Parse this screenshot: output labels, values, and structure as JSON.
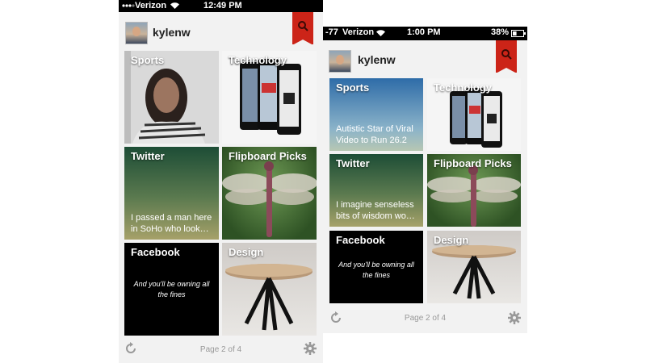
{
  "left_screen": {
    "status": {
      "carrier": "Verizon",
      "time": "12:49 PM"
    },
    "user": {
      "name": "kylenw"
    },
    "tiles": {
      "sports": {
        "label": "Sports"
      },
      "technology": {
        "label": "Technology"
      },
      "twitter": {
        "label": "Twitter",
        "text": "I passed a man here in SoHo who look…"
      },
      "flipboard_picks": {
        "label": "Flipboard Picks"
      },
      "facebook": {
        "label": "Facebook",
        "quote": "And you'll be owning all the fines"
      },
      "design": {
        "label": "Design"
      }
    },
    "footer": {
      "page": "Page 2 of 4"
    }
  },
  "right_screen": {
    "status": {
      "signal": "-77",
      "carrier": "Verizon",
      "time": "1:00 PM",
      "battery": "38%",
      "battery_level": 0.38
    },
    "user": {
      "name": "kylenw"
    },
    "tiles": {
      "sports": {
        "label": "Sports",
        "text": "Autistic Star of Viral Video to Run 26.2"
      },
      "technology": {
        "label": "Technology"
      },
      "twitter": {
        "label": "Twitter",
        "text": "I imagine senseless bits of wisdom wo…"
      },
      "flipboard_picks": {
        "label": "Flipboard Picks"
      },
      "facebook": {
        "label": "Facebook",
        "quote": "And you'll be owning all the fines"
      },
      "design": {
        "label": "Design"
      }
    },
    "footer": {
      "page": "Page 2 of 4"
    }
  },
  "icons": {
    "search": "magnifier-icon",
    "refresh": "refresh-icon",
    "settings": "gear-icon",
    "wifi": "wifi-icon",
    "battery": "battery-icon",
    "signal": "signal-dots-icon"
  },
  "colors": {
    "accent": "#cc2418"
  }
}
